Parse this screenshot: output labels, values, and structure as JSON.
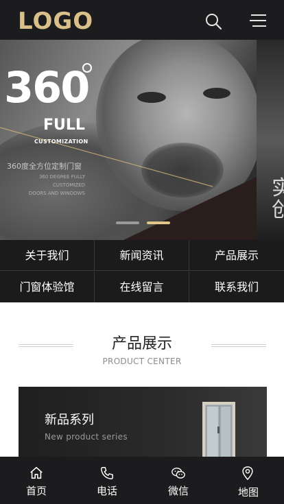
{
  "header": {
    "logo_text": "LOGO",
    "logo_color": "#d9c08a",
    "background": "#1c1c1e",
    "search_icon": "search-icon",
    "menu_icon": "hamburger-menu-icon"
  },
  "hero": {
    "big_number": "360",
    "full": "FULL",
    "customization": "CUSTOMIZATION",
    "cn_caption": "360度全方位定制门窗",
    "en_caption_lines": [
      "360 DEGREE FULLY",
      "CUSTOMIZED",
      "DOORS AND WINDOWS"
    ],
    "next_slide_text": [
      "实",
      "创"
    ],
    "active_slide": 2,
    "slide_count": 2,
    "dot_active_color": "#e2c58a",
    "dot_inactive_color": "#9a9a9a"
  },
  "nav": {
    "items": [
      {
        "label": "关于我们"
      },
      {
        "label": "新闻资讯"
      },
      {
        "label": "产品展示"
      },
      {
        "label": "门窗体验馆"
      },
      {
        "label": "在线留言"
      },
      {
        "label": "联系我们"
      }
    ]
  },
  "section": {
    "title": "产品展示",
    "subtitle": "PRODUCT CENTER"
  },
  "product": {
    "title": "新品系列",
    "subtitle": "New product series"
  },
  "tabbar": {
    "items": [
      {
        "label": "首页",
        "icon": "home-icon"
      },
      {
        "label": "电话",
        "icon": "phone-icon"
      },
      {
        "label": "微信",
        "icon": "wechat-icon"
      },
      {
        "label": "地图",
        "icon": "map-pin-icon"
      }
    ]
  }
}
